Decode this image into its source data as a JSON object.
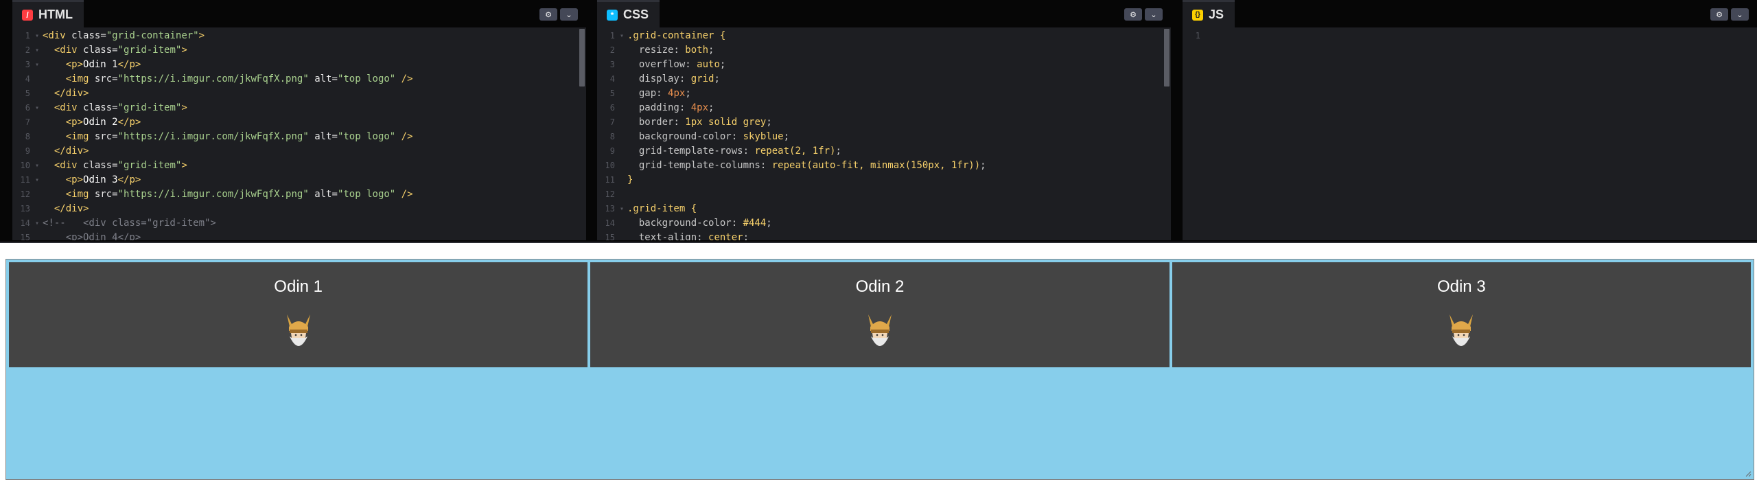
{
  "editors": {
    "html": {
      "tab_label": "HTML",
      "icon": "html-icon",
      "icon_color": "#ff3c41",
      "icon_glyph": "/",
      "line_numbers": [
        "1",
        "2",
        "3",
        "4",
        "5",
        "6",
        "7",
        "8",
        "9",
        "10",
        "11",
        "12",
        "13",
        "14",
        "15"
      ],
      "img_src": "\"https://i.imgur.com/jkwFqfX.png\"",
      "alt_value": "\"top logo\"",
      "class_container": "\"grid-container\"",
      "class_item": "\"grid-item\"",
      "p1": "Odin 1",
      "p2": "Odin 2",
      "p3": "Odin 3",
      "comment_line": "<!--   <div class=\"grid-item\">",
      "line15": "<p>Odin 4</p>"
    },
    "css": {
      "tab_label": "CSS",
      "icon": "css-icon",
      "icon_color": "#0ebeff",
      "icon_glyph": "*",
      "line_numbers": [
        "1",
        "2",
        "3",
        "4",
        "5",
        "6",
        "7",
        "8",
        "9",
        "10",
        "11",
        "12",
        "13",
        "14",
        "15"
      ],
      "sel1": ".grid-container {",
      "sel2": ".grid-item {",
      "close": "}",
      "props": [
        {
          "p": "resize",
          "v": "both"
        },
        {
          "p": "overflow",
          "v": "auto"
        },
        {
          "p": "display",
          "v": "grid"
        },
        {
          "p": "gap",
          "v": "4px"
        },
        {
          "p": "padding",
          "v": "4px"
        },
        {
          "p": "border",
          "v": "1px solid grey"
        },
        {
          "p": "background-color",
          "v": "skyblue"
        },
        {
          "p": "grid-template-rows",
          "v": "repeat(2, 1fr)"
        },
        {
          "p": "grid-template-columns",
          "v": "repeat(auto-fit, minmax(150px, 1fr))"
        },
        {
          "p": "background-color",
          "v": "#444"
        },
        {
          "p": "text-align",
          "v": "center"
        }
      ]
    },
    "js": {
      "tab_label": "JS",
      "icon": "js-icon",
      "icon_color": "#fcd000",
      "icon_glyph": "{}",
      "line_numbers": [
        "1"
      ]
    },
    "settings_icon": "gear-icon",
    "collapse_icon": "chevron-down-icon"
  },
  "preview": {
    "items": [
      {
        "label": "Odin 1",
        "img_alt": "top logo"
      },
      {
        "label": "Odin 2",
        "img_alt": "top logo"
      },
      {
        "label": "Odin 3",
        "img_alt": "top logo"
      }
    ],
    "background": "skyblue",
    "item_background": "#444444"
  }
}
